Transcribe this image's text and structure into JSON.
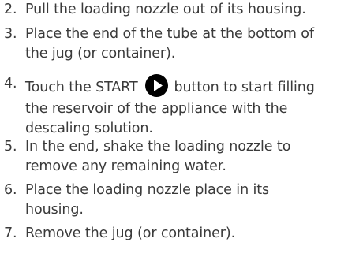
{
  "steps": [
    {
      "number": "2.",
      "lines": [
        "Pull the loading nozzle out of its housing."
      ]
    },
    {
      "number": "3.",
      "lines": [
        "Place the end of the tube at the bottom of",
        "the jug (or container)."
      ]
    },
    {
      "number": "4.",
      "lines_before_icon": "Touch the START",
      "icon": "play-icon",
      "lines_after_icon": "button to start filling",
      "lines": [
        "the reservoir of the appliance with the",
        "descaling solution."
      ]
    },
    {
      "number": "5.",
      "lines": [
        "In the end, shake the loading nozzle to",
        "remove any remaining water."
      ]
    },
    {
      "number": "6.",
      "lines": [
        "Place the loading nozzle place in its",
        "housing."
      ]
    },
    {
      "number": "7.",
      "lines": [
        "Remove the jug (or container)."
      ]
    }
  ]
}
